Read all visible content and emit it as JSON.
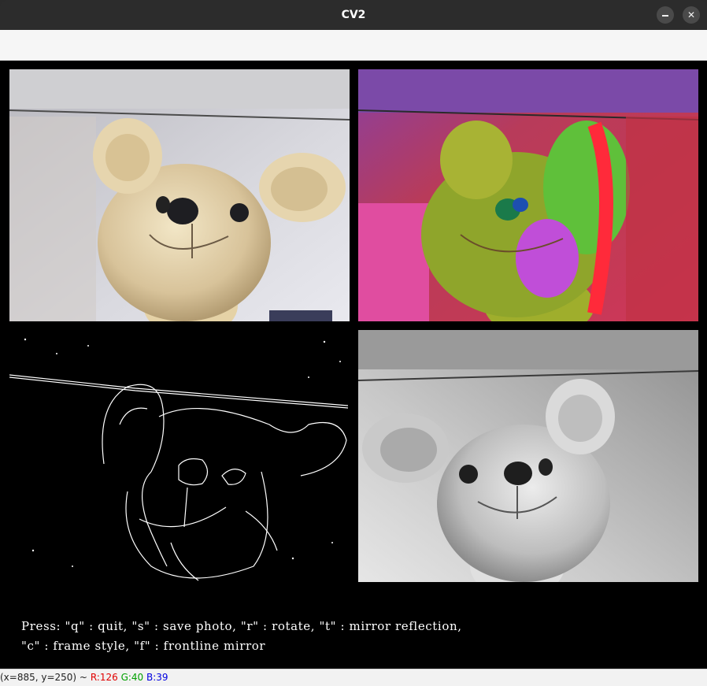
{
  "window": {
    "title": "CV2",
    "minimize_glyph": "–",
    "close_glyph": "✕"
  },
  "instructions": {
    "line1": "Press: \"q\" : quit, \"s\" : save photo, \"r\" : rotate, \"t\" : mirror reflection,",
    "line2": "\"c\" : frame style, \"f\" : frontline mirror"
  },
  "status": {
    "coords": "(x=885, y=250) ~",
    "r_text": "R:126",
    "g_text": "G:40",
    "b_text": "B:39",
    "r_color": "#e00000",
    "g_color": "#00a000",
    "b_color": "#0000e0"
  },
  "panels": {
    "original": {
      "icon": "teddy-bear-color-image"
    },
    "color_shift": {
      "icon": "teddy-bear-false-color-image"
    },
    "edges": {
      "icon": "teddy-bear-edge-detection-image"
    },
    "grayscale": {
      "icon": "teddy-bear-grayscale-mirrored-image"
    }
  }
}
